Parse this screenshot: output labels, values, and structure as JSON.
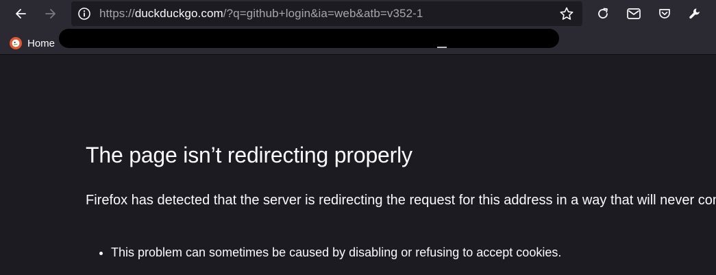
{
  "toolbar": {
    "back_icon": "arrow-left-icon",
    "forward_icon": "arrow-right-icon",
    "reload_icon": "reload-icon",
    "mail_icon": "mail-icon",
    "pocket_icon": "pocket-icon",
    "wrench_icon": "wrench-icon"
  },
  "urlbar": {
    "scheme": "https://",
    "host": "duckduckgo.com",
    "path": "/?q=github+login&ia=web&atb=v352-1",
    "info_icon": "info-icon",
    "star_icon": "star-icon"
  },
  "bookmarks": {
    "home_label": "Home",
    "home_icon": "duckduckgo-logo-icon"
  },
  "error": {
    "title": "The page isn’t redirecting properly",
    "description": "Firefox has detected that the server is redirecting the request for this address in a way that will never complete.",
    "bullets": [
      "This problem can sometimes be caused by disabling or refusing to accept cookies."
    ]
  },
  "colors": {
    "toolbar_bg": "#2b2a33",
    "page_bg": "#1c1b22",
    "text": "#fbfbfe",
    "ddg_orange": "#de5833"
  }
}
